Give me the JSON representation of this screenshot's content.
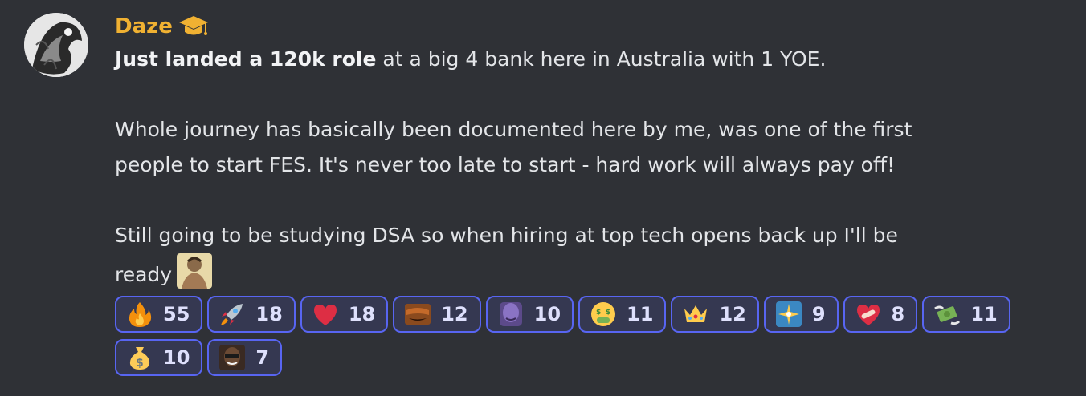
{
  "message": {
    "author": "Daze",
    "author_badge_icon": "graduation-cap-icon",
    "bold_lead": "Just landed a 120k role",
    "line1_rest": " at a big 4 bank here in Australia with 1 YOE.",
    "para2_line1": "Whole journey has basically been documented here by me, was one of the first",
    "para2_line2": "people to start FES. It's never too late to start - hard work will always pay off!",
    "para3_line1": "Still going to be studying DSA so when hiring at top tech opens back up I'll be",
    "para3_line2": "ready",
    "inline_emoji": "gigachad-emoji"
  },
  "reactions": [
    {
      "emoji": "fire",
      "count": "55"
    },
    {
      "emoji": "rocket",
      "count": "18"
    },
    {
      "emoji": "red-heart",
      "count": "18"
    },
    {
      "emoji": "custom-face",
      "count": "12"
    },
    {
      "emoji": "custom-purple-face",
      "count": "10"
    },
    {
      "emoji": "money-mouth-face",
      "count": "11"
    },
    {
      "emoji": "crown",
      "count": "12"
    },
    {
      "emoji": "sparkle-burst",
      "count": "9"
    },
    {
      "emoji": "heart-with-bandage",
      "count": "8"
    },
    {
      "emoji": "flying-money",
      "count": "11"
    },
    {
      "emoji": "money-bag",
      "count": "10"
    },
    {
      "emoji": "custom-person",
      "count": "7"
    }
  ],
  "colors": {
    "background": "#2f3136",
    "username": "#f0b132",
    "reaction_border": "#5865f2"
  }
}
